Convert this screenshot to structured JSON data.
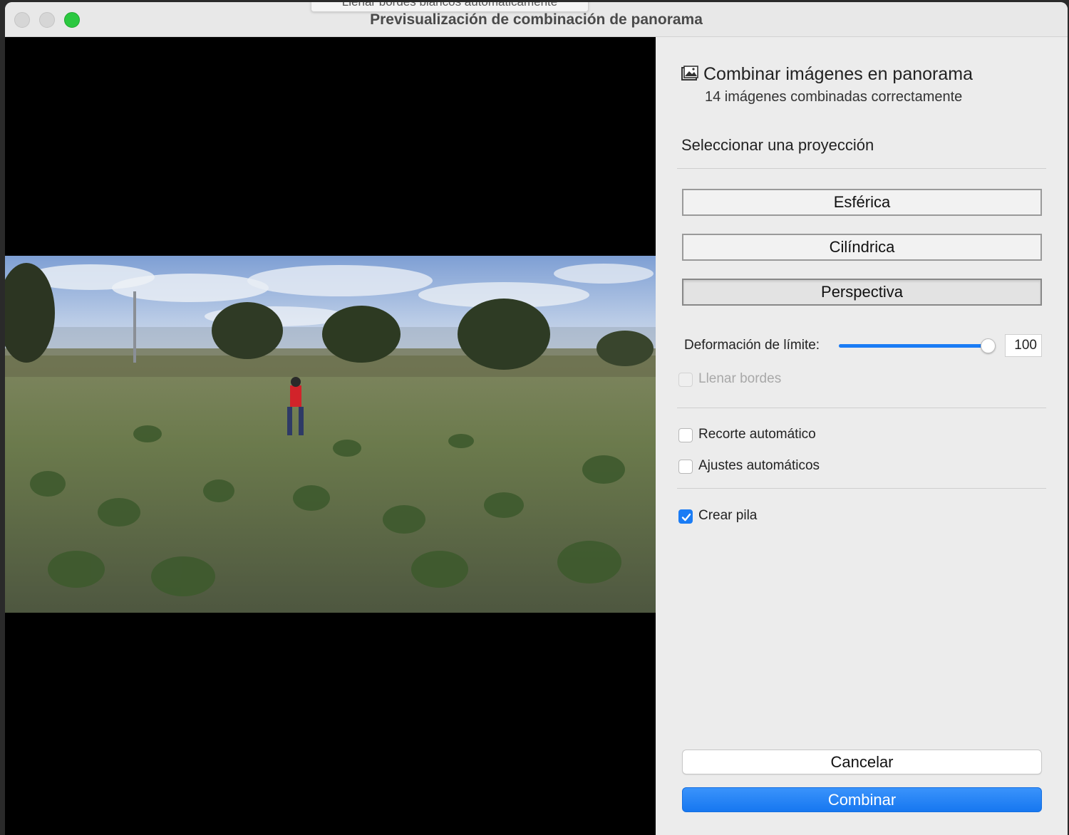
{
  "window": {
    "title": "Previsualización de combinación de panorama",
    "tooltip": "Llenar bordes blancos automáticamente"
  },
  "panel": {
    "icon": "panorama-photo-icon",
    "heading": "Combinar imágenes en panorama",
    "subheading": "14 imágenes combinadas correctamente",
    "projection_label": "Seleccionar una proyección",
    "projections": [
      {
        "label": "Esférica",
        "active": false
      },
      {
        "label": "Cilíndrica",
        "active": false
      },
      {
        "label": "Perspectiva",
        "active": true
      }
    ],
    "boundary_warp": {
      "label": "Deformación de límite:",
      "value": "100",
      "fraction": 0.95
    },
    "options": {
      "fill_edges": {
        "label": "Llenar bordes",
        "checked": false,
        "disabled": true
      },
      "auto_crop": {
        "label": "Recorte automático",
        "checked": false
      },
      "auto_settings": {
        "label": "Ajustes automáticos",
        "checked": false
      },
      "create_stack": {
        "label": "Crear pila",
        "checked": true
      }
    },
    "cancel_label": "Cancelar",
    "combine_label": "Combinar"
  },
  "colors": {
    "accent": "#1a7cf5",
    "zoom_green": "#2bc840"
  }
}
